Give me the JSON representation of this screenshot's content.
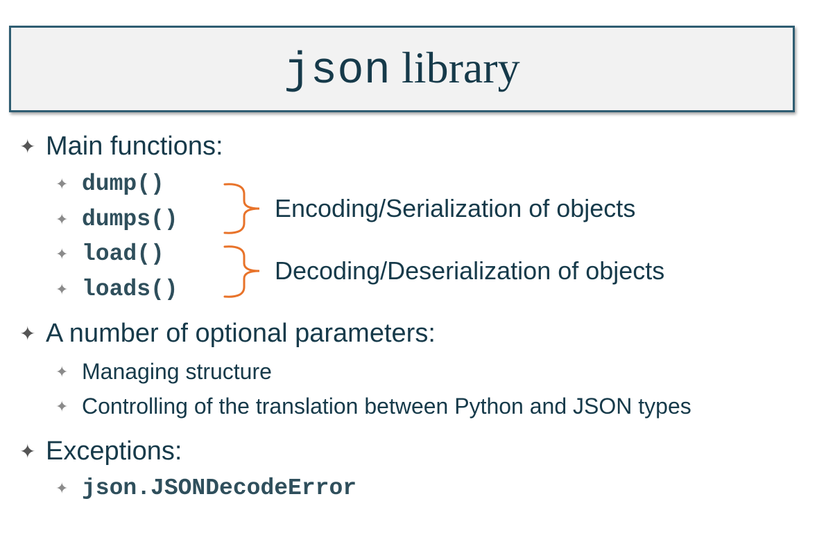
{
  "title": {
    "code_part": "json",
    "text_part": " library"
  },
  "bullets": [
    {
      "text": "Main functions:"
    },
    {
      "text": "A number of optional parameters:"
    },
    {
      "text": "Exceptions:"
    }
  ],
  "functions": [
    "dump()",
    "dumps()",
    "load()",
    "loads()"
  ],
  "groups": [
    {
      "label": "Encoding/Serialization of objects",
      "color": "#e8732a"
    },
    {
      "label": "Decoding/Deserialization of objects",
      "color": "#e8732a"
    }
  ],
  "parameters": [
    "Managing structure",
    "Controlling of the translation between Python and JSON types"
  ],
  "exceptions": [
    "json.JSONDecodeError"
  ],
  "bullet_icon": "four-point-star-icon"
}
